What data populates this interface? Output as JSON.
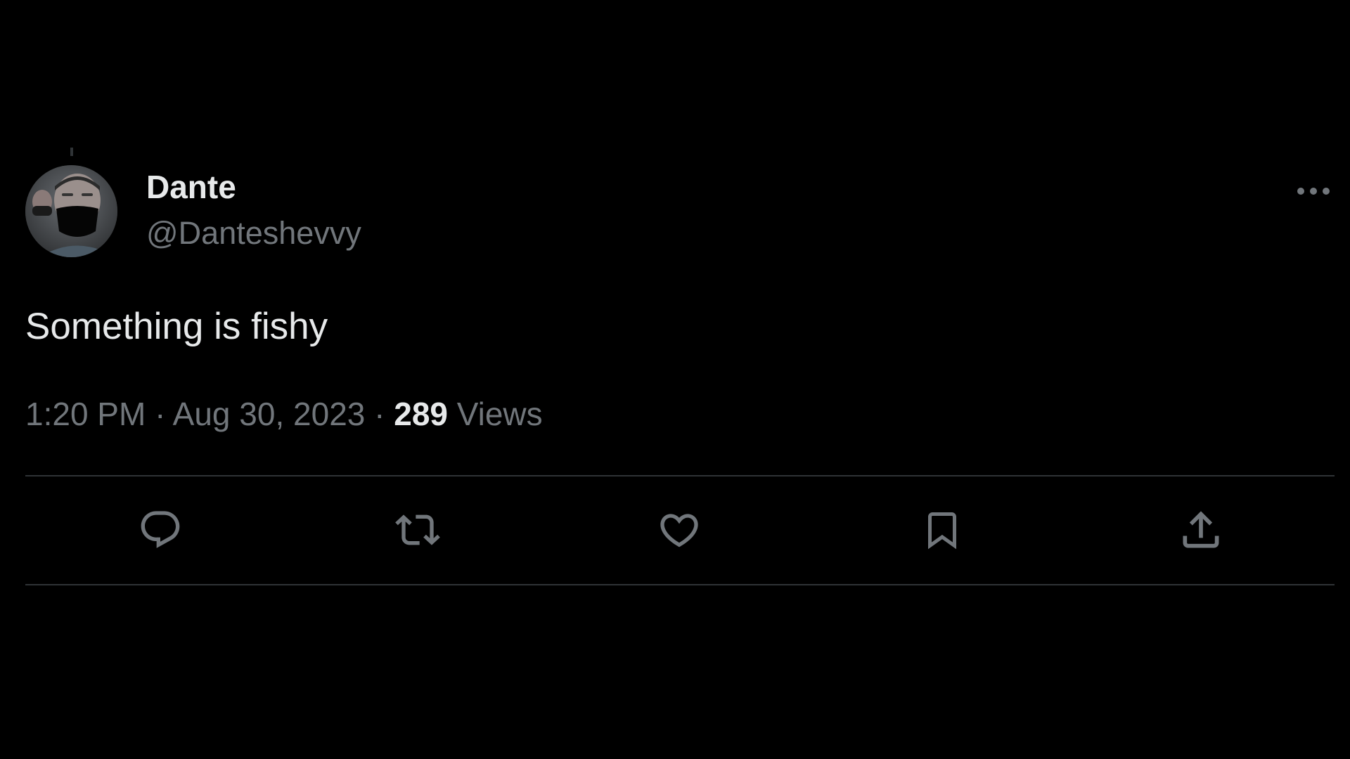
{
  "author": {
    "display_name": "Dante",
    "handle": "@Danteshevvy"
  },
  "tweet": {
    "text": "Something is fishy",
    "time": "1:20 PM",
    "separator": "·",
    "date": "Aug 30, 2023",
    "views_count": "289",
    "views_label": "Views"
  },
  "actions": [
    {
      "icon": "reply-icon"
    },
    {
      "icon": "retweet-icon"
    },
    {
      "icon": "like-icon"
    },
    {
      "icon": "bookmark-icon"
    },
    {
      "icon": "share-icon"
    }
  ],
  "colors": {
    "background": "#000000",
    "primary_text": "#e7e9ea",
    "secondary_text": "#71767b",
    "divider": "#2f3336"
  }
}
